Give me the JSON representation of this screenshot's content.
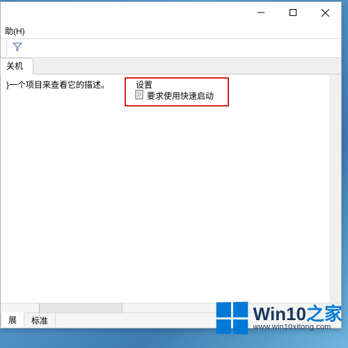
{
  "menu": {
    "help": "助(H)"
  },
  "tab": {
    "title": "关机"
  },
  "left_pane": {
    "description_hint": "}一个项目来查看它的描述。"
  },
  "right_pane": {
    "group_title": "设置",
    "policy_label": "要求使用快速启动"
  },
  "bottom_tabs": {
    "extended": "展",
    "standard": "标准"
  },
  "watermark": {
    "brand_main": "Win10",
    "brand_suffix": "之家",
    "url": "www.win10xitong.com"
  }
}
